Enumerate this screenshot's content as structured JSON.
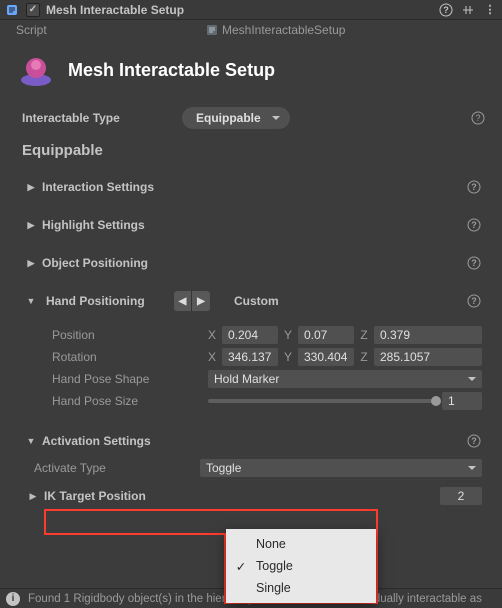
{
  "window": {
    "title": "Mesh Interactable Setup"
  },
  "script": {
    "label": "Script",
    "value": "MeshInteractableSetup"
  },
  "header": {
    "title": "Mesh Interactable Setup"
  },
  "interactable_type": {
    "label": "Interactable Type",
    "value": "Equippable"
  },
  "equippable_section": {
    "title": "Equippable",
    "interaction_settings": "Interaction Settings",
    "highlight_settings": "Highlight Settings",
    "object_positioning": "Object Positioning",
    "hand_positioning": {
      "label": "Hand Positioning",
      "mode": "Custom",
      "position": {
        "label": "Position",
        "x": "0.204",
        "y": "0.07",
        "z": "0.379"
      },
      "rotation": {
        "label": "Rotation",
        "x": "346.1378",
        "y": "330.4046",
        "z": "285.1057"
      },
      "hand_pose_shape": {
        "label": "Hand Pose Shape",
        "value": "Hold Marker"
      },
      "hand_pose_size": {
        "label": "Hand Pose Size",
        "value": "1"
      }
    },
    "activation_settings": {
      "label": "Activation Settings",
      "activate_type": {
        "label": "Activate Type",
        "value": "Toggle",
        "options": [
          "None",
          "Toggle",
          "Single"
        ],
        "selected": "Toggle"
      }
    },
    "ik_target_position": {
      "label": "IK Target Position",
      "count": "2"
    }
  },
  "footer": {
    "text": "Found 1 Rigidbody object(s) in the hierarchy below that will be individually interactable as"
  }
}
